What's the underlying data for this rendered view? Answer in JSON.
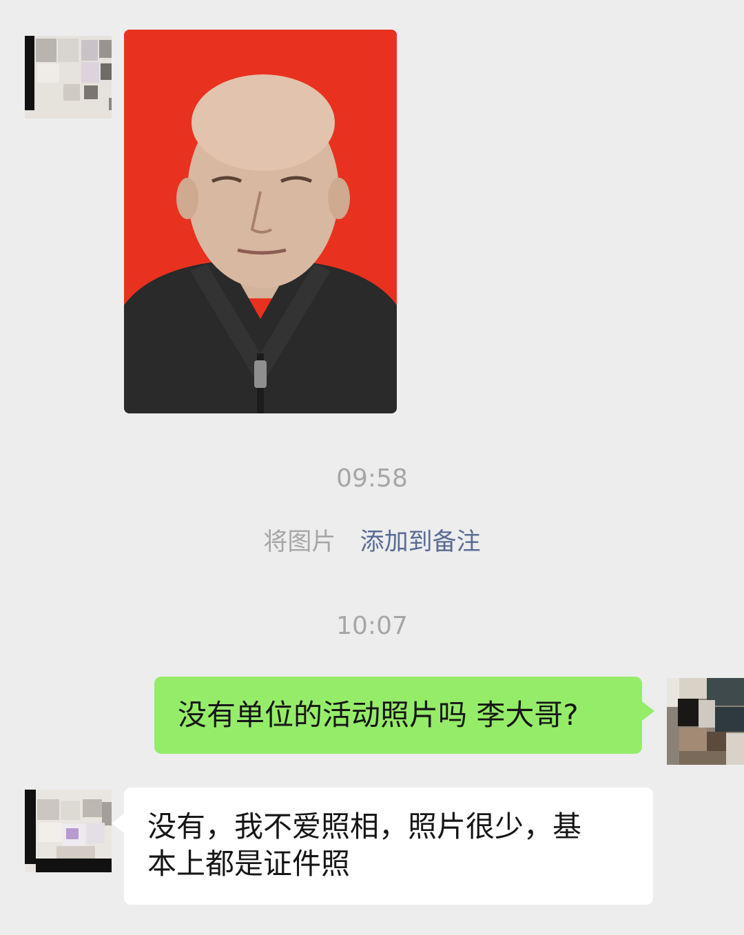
{
  "messages": {
    "photo": {
      "alt": "portrait photo"
    },
    "timestamp_1": "09:58",
    "hint": {
      "prefix": "将图片",
      "link": "添加到备注"
    },
    "timestamp_2": "10:07",
    "outgoing": {
      "text": "没有单位的活动照片吗 李大哥?"
    },
    "incoming": {
      "text": "没有，我不爱照相，照片很少，基\n本上都是证件照"
    }
  },
  "colors": {
    "background": "#ededed",
    "outgoing_bubble": "#95ec69",
    "incoming_bubble": "#ffffff",
    "link": "#5a6b94",
    "photo_background": "#e8321f"
  }
}
